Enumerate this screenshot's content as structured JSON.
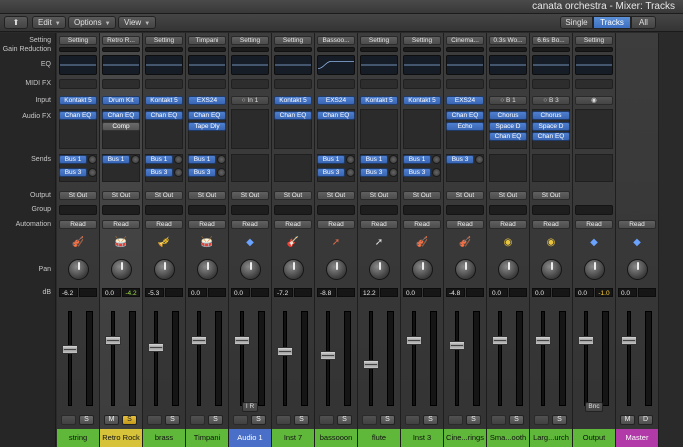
{
  "window": {
    "title": "canata orchestra - Mixer: Tracks"
  },
  "toolbar": {
    "edit_label": "Edit",
    "options_label": "Options",
    "view_label": "View",
    "views": [
      "Single",
      "Tracks",
      "All"
    ],
    "active_view": "Tracks"
  },
  "row_labels": {
    "setting": "Setting",
    "gain_reduction": "Gain Reduction",
    "eq": "EQ",
    "midi_fx": "MIDI FX",
    "input": "Input",
    "audio_fx": "Audio FX",
    "sends": "Sends",
    "output": "Output",
    "group": "Group",
    "automation": "Automation",
    "pan": "Pan",
    "db": "dB"
  },
  "colors": {
    "green": "#5fb83a",
    "yellow": "#d7c33a",
    "blue": "#4a6fc8",
    "magenta": "#b23aa8"
  },
  "strips": [
    {
      "name": "string",
      "setting": "Setting",
      "input": "Kontakt 5",
      "input_type": "inst",
      "fx": [
        "Chan EQ"
      ],
      "sends": [
        "Bus 1",
        "Bus 3"
      ],
      "output": "St Out",
      "automation": "Read",
      "icon": "violin-icon",
      "db": "-6.2",
      "peak": "",
      "fader": 0.62,
      "mute": "",
      "solo": "S",
      "solo_active": false,
      "color": "#5fb83a"
    },
    {
      "name": "Retro Rock",
      "setting": "Retro R...",
      "input": "Drum Kit",
      "input_type": "inst",
      "fx": [
        "Chan EQ",
        "Comp"
      ],
      "sends": [
        "Bus 1"
      ],
      "output": "St Out",
      "automation": "Read",
      "icon": "drum-icon",
      "db": "0.0",
      "peak": "-4.2",
      "fader": 0.72,
      "mute": "M",
      "solo": "S",
      "solo_active": true,
      "color": "#d7c33a",
      "selected": true
    },
    {
      "name": "brass",
      "setting": "Setting",
      "input": "Kontakt 5",
      "input_type": "inst",
      "fx": [
        "Chan EQ"
      ],
      "sends": [
        "Bus 1",
        "Bus 3"
      ],
      "output": "St Out",
      "automation": "Read",
      "icon": "brass-icon",
      "db": "-5.3",
      "peak": "",
      "fader": 0.64,
      "mute": "",
      "solo": "S",
      "solo_active": false,
      "color": "#5fb83a"
    },
    {
      "name": "Timpani",
      "setting": "Timpani",
      "input": "EXS24",
      "input_type": "inst",
      "fx": [
        "Chan EQ",
        "Tape Dly"
      ],
      "sends": [
        "Bus 1",
        "Bus 3"
      ],
      "output": "St Out",
      "automation": "Read",
      "icon": "timpani-icon",
      "db": "0.0",
      "peak": "",
      "fader": 0.72,
      "mute": "",
      "solo": "S",
      "solo_active": false,
      "color": "#5fb83a"
    },
    {
      "name": "Audio 1",
      "setting": "Setting",
      "input": "In 1",
      "input_type": "mono",
      "fx": [],
      "sends": [],
      "output": "St Out",
      "automation": "Read",
      "icon": "waveform-icon",
      "db": "0.0",
      "peak": "",
      "fader": 0.72,
      "mute": "",
      "solo": "S",
      "solo_active": false,
      "color": "#4a6fc8",
      "extra": "I R"
    },
    {
      "name": "Inst 7",
      "setting": "Setting",
      "input": "Kontakt 5",
      "input_type": "inst",
      "fx": [
        "Chan EQ"
      ],
      "sends": [],
      "output": "St Out",
      "automation": "Read",
      "icon": "guitar-icon",
      "db": "-7.2",
      "peak": "",
      "fader": 0.6,
      "mute": "",
      "solo": "S",
      "solo_active": false,
      "color": "#5fb83a"
    },
    {
      "name": "bassooon",
      "setting": "Bassoo...",
      "input": "EXS24",
      "input_type": "inst",
      "fx": [
        "Chan EQ"
      ],
      "sends": [
        "Bus 1",
        "Bus 3"
      ],
      "output": "St Out",
      "automation": "Read",
      "icon": "bassoon-icon",
      "db": "-8.8",
      "peak": "",
      "fader": 0.56,
      "mute": "",
      "solo": "S",
      "solo_active": false,
      "color": "#5fb83a"
    },
    {
      "name": "flute",
      "setting": "Setting",
      "input": "Kontakt 5",
      "input_type": "inst",
      "fx": [],
      "sends": [
        "Bus 1",
        "Bus 3"
      ],
      "output": "St Out",
      "automation": "Read",
      "icon": "flute-icon",
      "db": "12.2",
      "peak": "",
      "fader": 0.46,
      "mute": "",
      "solo": "S",
      "solo_active": false,
      "color": "#5fb83a"
    },
    {
      "name": "Inst 3",
      "setting": "Setting",
      "input": "Kontakt 5",
      "input_type": "inst",
      "fx": [],
      "sends": [
        "Bus 1",
        "Bus 3"
      ],
      "output": "St Out",
      "automation": "Read",
      "icon": "strings-icon",
      "db": "0.0",
      "peak": "",
      "fader": 0.72,
      "mute": "",
      "solo": "S",
      "solo_active": false,
      "color": "#5fb83a"
    },
    {
      "name": "Cine...rings",
      "setting": "Cinema...",
      "input": "EXS24",
      "input_type": "inst",
      "fx": [
        "Chan EQ",
        "Echo"
      ],
      "sends": [
        "Bus 3"
      ],
      "output": "St Out",
      "automation": "Read",
      "icon": "strings-icon",
      "db": "-4.8",
      "peak": "",
      "fader": 0.66,
      "mute": "",
      "solo": "S",
      "solo_active": false,
      "color": "#5fb83a"
    },
    {
      "name": "Sma...ooth",
      "setting": "0.3s Wo...",
      "input": "B 1",
      "input_type": "mono",
      "fx": [
        "Chorus",
        "Space D",
        "Chan EQ"
      ],
      "sends": [],
      "output": "St Out",
      "automation": "Read",
      "icon": "aux-icon",
      "db": "0.0",
      "peak": "",
      "fader": 0.72,
      "mute": "",
      "solo": "S",
      "solo_active": false,
      "color": "#5fb83a"
    },
    {
      "name": "Larg...urch",
      "setting": "6.6s Bo...",
      "input": "B 3",
      "input_type": "mono",
      "fx": [
        "Chorus",
        "Space D",
        "Chan EQ"
      ],
      "sends": [],
      "output": "St Out",
      "automation": "Read",
      "icon": "aux-icon",
      "db": "0.0",
      "peak": "",
      "fader": 0.72,
      "mute": "",
      "solo": "S",
      "solo_active": false,
      "color": "#5fb83a"
    },
    {
      "name": "Output",
      "setting": "Setting",
      "input": "",
      "input_type": "link",
      "fx": [],
      "sends": [],
      "output": "",
      "automation": "Read",
      "icon": "output-icon",
      "db": "0.0",
      "peak": "-1.0",
      "fader": 0.72,
      "mute": "",
      "solo": "",
      "solo_active": false,
      "color": "#5fb83a",
      "extra": "Bnc"
    },
    {
      "name": "Master",
      "setting": "",
      "input": "",
      "input_type": "none",
      "fx": [],
      "sends": [],
      "output": "",
      "automation": "Read",
      "icon": "master-icon",
      "db": "0.0",
      "peak": "",
      "fader": 0.72,
      "mute": "M",
      "solo": "D",
      "solo_active": false,
      "color": "#b23aa8"
    }
  ]
}
